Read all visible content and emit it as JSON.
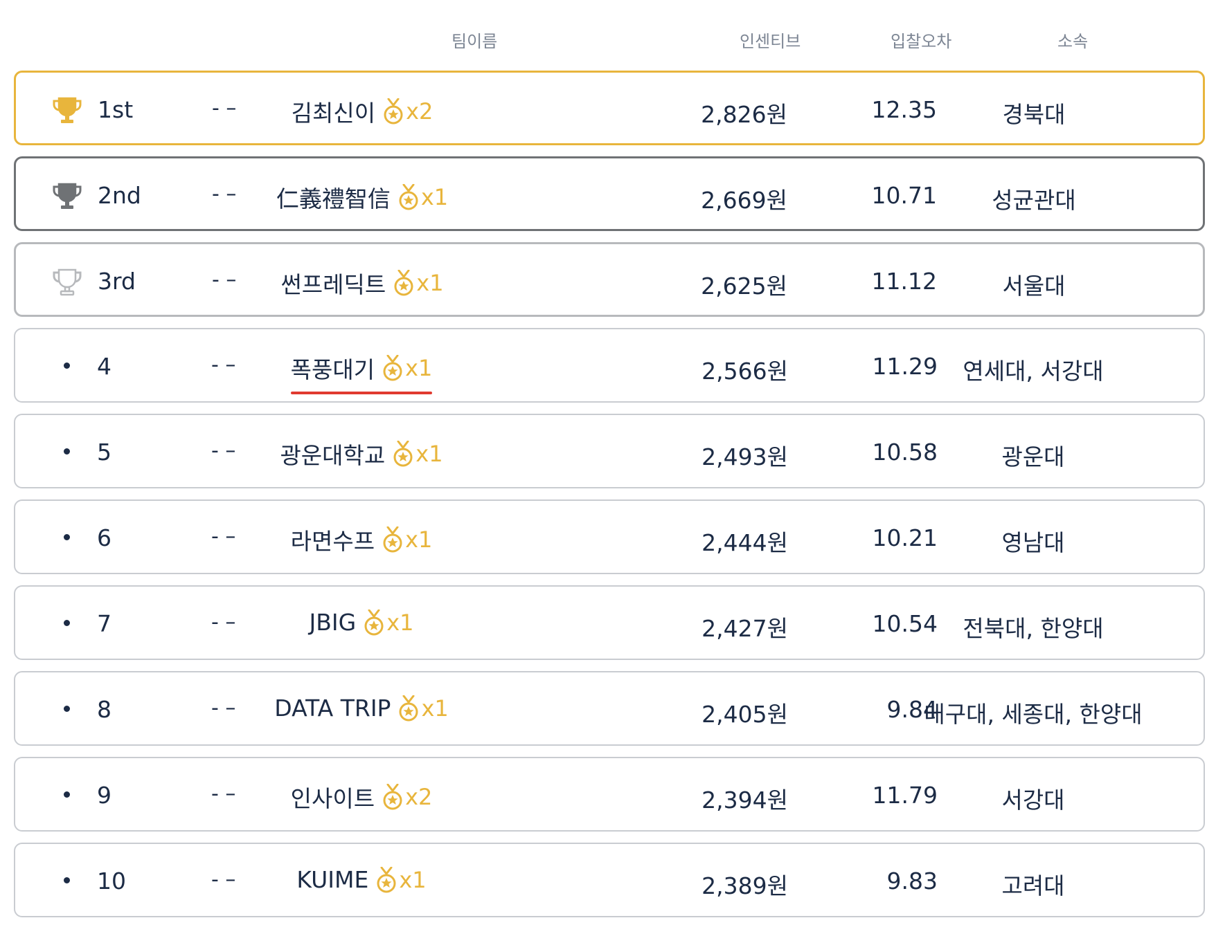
{
  "header": {
    "team": "팀이름",
    "incentive": "인센티브",
    "error": "입찰오차",
    "affiliation": "소속"
  },
  "colors": {
    "gold": "#e8b53c",
    "silver_dark": "#6f7275",
    "bronze_light": "#b7b9bc",
    "text": "#1c2b45",
    "underline": "#e03a2f"
  },
  "rows": [
    {
      "rank": "1st",
      "change": "- –",
      "team": "김최신이",
      "medals": "x2",
      "incentive": "2,826원",
      "error": "12.35",
      "affiliation": "경북대",
      "icon": "trophy-gold-icon"
    },
    {
      "rank": "2nd",
      "change": "- –",
      "team": "仁義禮智信",
      "medals": "x1",
      "incentive": "2,669원",
      "error": "10.71",
      "affiliation": "성균관대",
      "icon": "trophy-dark-icon"
    },
    {
      "rank": "3rd",
      "change": "- –",
      "team": "썬프레딕트",
      "medals": "x1",
      "incentive": "2,625원",
      "error": "11.12",
      "affiliation": "서울대",
      "icon": "trophy-outline-icon"
    },
    {
      "rank": "4",
      "change": "- –",
      "team": "폭풍대기",
      "medals": "x1",
      "incentive": "2,566원",
      "error": "11.29",
      "affiliation": "연세대, 서강대",
      "icon": "bullet-dot"
    },
    {
      "rank": "5",
      "change": "- –",
      "team": "광운대학교",
      "medals": "x1",
      "incentive": "2,493원",
      "error": "10.58",
      "affiliation": "광운대",
      "icon": "bullet-dot"
    },
    {
      "rank": "6",
      "change": "- –",
      "team": "라면수프",
      "medals": "x1",
      "incentive": "2,444원",
      "error": "10.21",
      "affiliation": "영남대",
      "icon": "bullet-dot"
    },
    {
      "rank": "7",
      "change": "- –",
      "team": "JBIG",
      "medals": "x1",
      "incentive": "2,427원",
      "error": "10.54",
      "affiliation": "전북대, 한양대",
      "icon": "bullet-dot"
    },
    {
      "rank": "8",
      "change": "- –",
      "team": "DATA TRIP",
      "medals": "x1",
      "incentive": "2,405원",
      "error": "9.84",
      "affiliation": "대구대, 세종대, 한양대",
      "icon": "bullet-dot"
    },
    {
      "rank": "9",
      "change": "- –",
      "team": "인사이트",
      "medals": "x2",
      "incentive": "2,394원",
      "error": "11.79",
      "affiliation": "서강대",
      "icon": "bullet-dot"
    },
    {
      "rank": "10",
      "change": "- –",
      "team": "KUIME",
      "medals": "x1",
      "incentive": "2,389원",
      "error": "9.83",
      "affiliation": "고려대",
      "icon": "bullet-dot"
    }
  ]
}
